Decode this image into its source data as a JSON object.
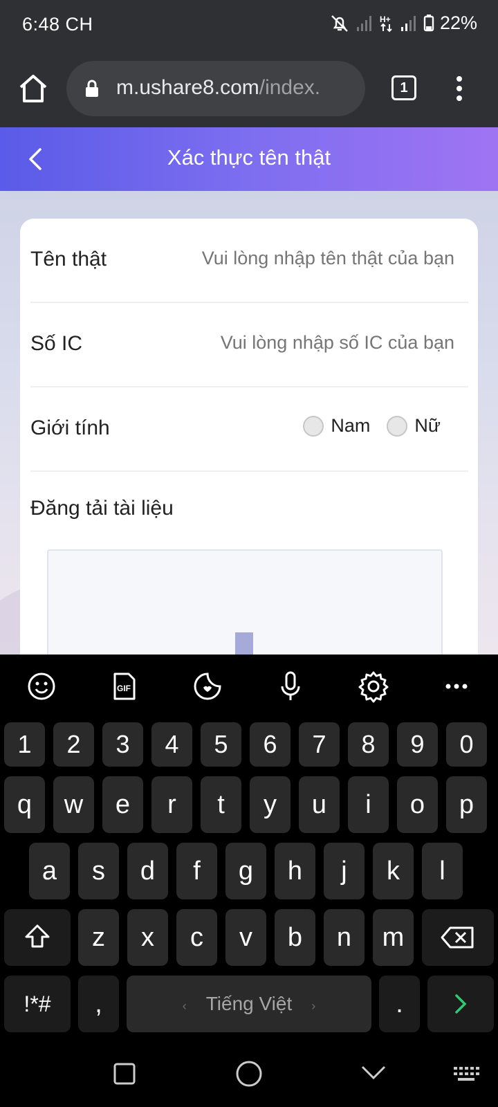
{
  "status_bar": {
    "time": "6:48 CH",
    "battery": "22%",
    "icons": [
      "mute-icon",
      "signal-icon",
      "data-icon",
      "signal-icon",
      "battery-icon"
    ]
  },
  "browser": {
    "url_host": "m.ushare8.com",
    "url_path": "/index.",
    "tab_count": "1"
  },
  "header": {
    "title": "Xác thực tên thật"
  },
  "form": {
    "name_label": "Tên thật",
    "name_placeholder": "Vui lòng nhập tên thật của bạn",
    "ic_label": "Số IC",
    "ic_placeholder": "Vui lòng nhập số IC của bạn",
    "gender_label": "Giới tính",
    "gender_options": [
      "Nam",
      "Nữ"
    ],
    "upload_label": "Đăng tải tài liệu"
  },
  "keyboard": {
    "number_row": [
      "1",
      "2",
      "3",
      "4",
      "5",
      "6",
      "7",
      "8",
      "9",
      "0"
    ],
    "row1": [
      "q",
      "w",
      "e",
      "r",
      "t",
      "y",
      "u",
      "i",
      "o",
      "p"
    ],
    "row2": [
      "a",
      "s",
      "d",
      "f",
      "g",
      "h",
      "j",
      "k",
      "l"
    ],
    "row3": [
      "z",
      "x",
      "c",
      "v",
      "b",
      "n",
      "m"
    ],
    "symbols_key": "!*#",
    "comma_key": ",",
    "space_label": "Tiếng Việt",
    "period_key": ".",
    "accent_color": "#2ecc71"
  }
}
